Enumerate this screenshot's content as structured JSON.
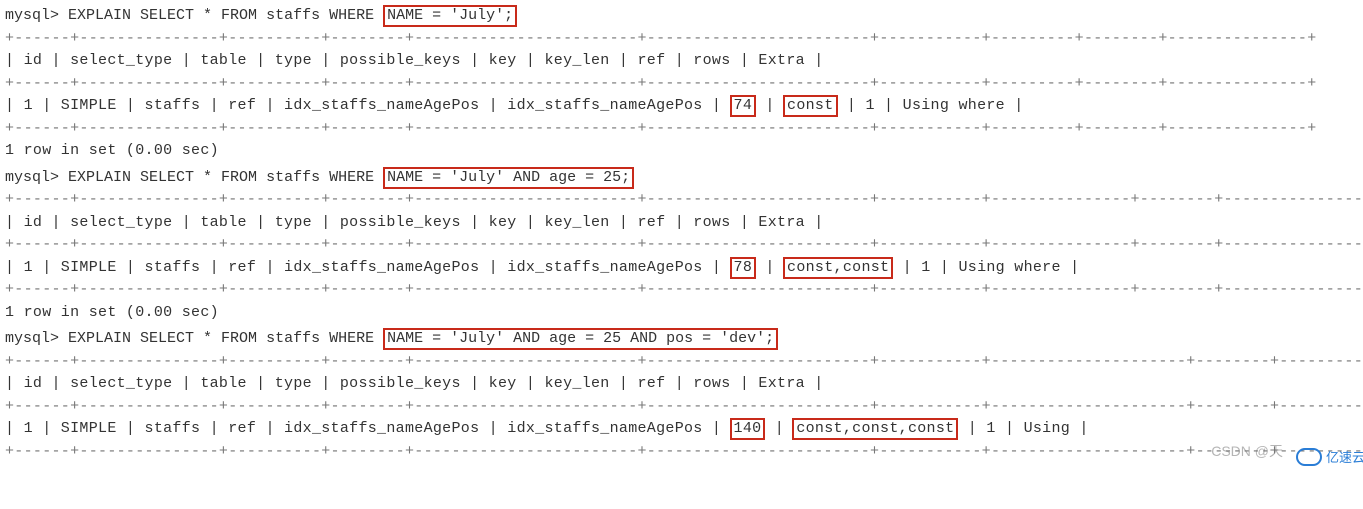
{
  "queries": [
    {
      "prompt": "mysql>",
      "stmt_prefix": "EXPLAIN SELECT * FROM staffs WHERE",
      "stmt_hl": "NAME = 'July';",
      "stmt_suffix": "",
      "header": {
        "id": "id",
        "select_type": "select_type",
        "table": "table",
        "type": "type",
        "possible_keys": "possible_keys",
        "key": "key",
        "key_len": "key_len",
        "ref": "ref",
        "rows": "rows",
        "Extra": "Extra"
      },
      "row": {
        "id": "1",
        "select_type": "SIMPLE",
        "table": "staffs",
        "type": "ref",
        "possible_keys": "idx_staffs_nameAgePos",
        "key": "idx_staffs_nameAgePos",
        "key_len": "74",
        "ref": "const",
        "rows": "1",
        "Extra": "Using where"
      },
      "footer": "1 row in set (0.00 sec)"
    },
    {
      "prompt": "mysql>",
      "stmt_prefix": "EXPLAIN SELECT * FROM staffs WHERE",
      "stmt_hl": "NAME = 'July' AND age = 25;",
      "stmt_suffix": "",
      "header": {
        "id": "id",
        "select_type": "select_type",
        "table": "table",
        "type": "type",
        "possible_keys": "possible_keys",
        "key": "key",
        "key_len": "key_len",
        "ref": "ref",
        "rows": "rows",
        "Extra": "Extra"
      },
      "row": {
        "id": "1",
        "select_type": "SIMPLE",
        "table": "staffs",
        "type": "ref",
        "possible_keys": "idx_staffs_nameAgePos",
        "key": "idx_staffs_nameAgePos",
        "key_len": "78",
        "ref": "const,const",
        "rows": "1",
        "Extra": "Using where"
      },
      "footer": "1 row in set (0.00 sec)"
    },
    {
      "prompt": "mysql>",
      "stmt_prefix": "EXPLAIN SELECT * FROM staffs WHERE",
      "stmt_hl": "NAME = 'July' AND age = 25 AND pos = 'dev';",
      "stmt_suffix": "",
      "header": {
        "id": "id",
        "select_type": "select_type",
        "table": "table",
        "type": "type",
        "possible_keys": "possible_keys",
        "key": "key",
        "key_len": "key_len",
        "ref": "ref",
        "rows": "rows",
        "Extra": "Extra"
      },
      "row": {
        "id": "1",
        "select_type": "SIMPLE",
        "table": "staffs",
        "type": "ref",
        "possible_keys": "idx_staffs_nameAgePos",
        "key": "idx_staffs_nameAgePos",
        "key_len": "140",
        "ref": "const,const,const",
        "rows": "1",
        "Extra": "Using"
      },
      "footer": ""
    }
  ],
  "widths": [
    {
      "id": 4,
      "select_type": 13,
      "table": 8,
      "type": 6,
      "possible_keys": 22,
      "key": 22,
      "key_len": 9,
      "ref": 7,
      "rows": 6,
      "Extra": 13
    },
    {
      "id": 4,
      "select_type": 13,
      "table": 8,
      "type": 6,
      "possible_keys": 22,
      "key": 22,
      "key_len": 9,
      "ref": 13,
      "rows": 6,
      "Extra": 13
    },
    {
      "id": 4,
      "select_type": 13,
      "table": 8,
      "type": 6,
      "possible_keys": 22,
      "key": 22,
      "key_len": 9,
      "ref": 19,
      "rows": 6,
      "Extra": 7
    }
  ],
  "watermark": "CSDN @天",
  "brand": "亿速云"
}
